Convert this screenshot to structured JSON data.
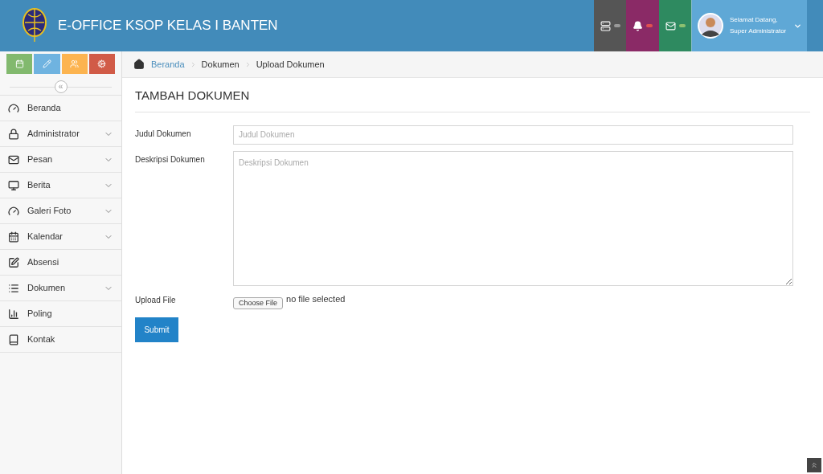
{
  "header": {
    "title": "E-OFFICE KSOP KELAS I BANTEN",
    "user": {
      "greeting": "Selamat Datang,",
      "name": "Super Administrator"
    }
  },
  "sidebar": {
    "collapse_label": "«",
    "items": [
      {
        "label": "Beranda",
        "has_submenu": false
      },
      {
        "label": "Administrator",
        "has_submenu": true
      },
      {
        "label": "Pesan",
        "has_submenu": true
      },
      {
        "label": "Berita",
        "has_submenu": true
      },
      {
        "label": "Galeri Foto",
        "has_submenu": true
      },
      {
        "label": "Kalendar",
        "has_submenu": true
      },
      {
        "label": "Absensi",
        "has_submenu": false
      },
      {
        "label": "Dokumen",
        "has_submenu": true
      },
      {
        "label": "Poling",
        "has_submenu": false
      },
      {
        "label": "Kontak",
        "has_submenu": false
      }
    ]
  },
  "breadcrumb": [
    {
      "label": "Beranda",
      "link": true
    },
    {
      "label": "Dokumen",
      "link": false
    },
    {
      "label": "Upload Dokumen",
      "link": false
    }
  ],
  "form": {
    "title": "TAMBAH DOKUMEN",
    "title_field": {
      "label": "Judul Dokumen",
      "placeholder": "Judul Dokumen"
    },
    "description_field": {
      "label": "Deskripsi Dokumen",
      "placeholder": "Deskripsi Dokumen"
    },
    "file_field": {
      "label": "Upload File",
      "button": "Choose File",
      "status": "no file selected"
    },
    "submit": "Submit"
  }
}
